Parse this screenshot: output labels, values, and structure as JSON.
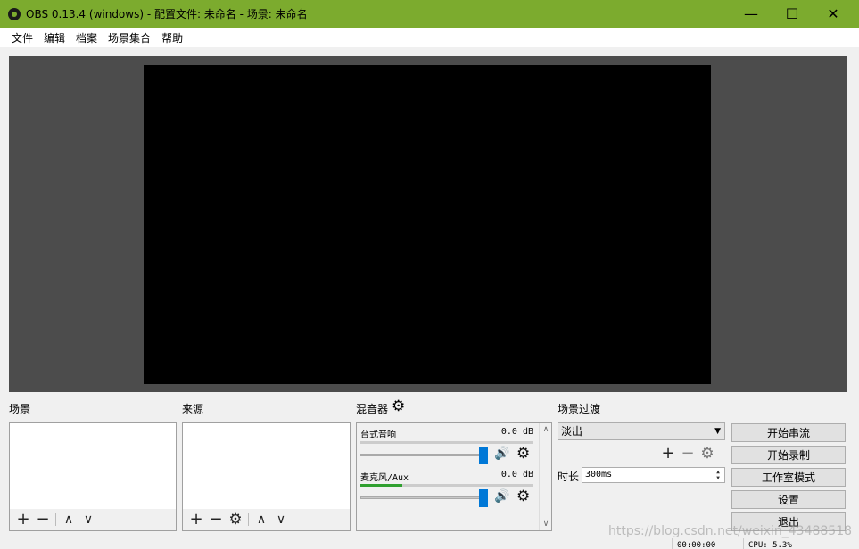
{
  "window": {
    "title": "OBS 0.13.4 (windows) - 配置文件: 未命名 - 场景: 未命名",
    "controls": {
      "minimize": "—",
      "maximize": "☐",
      "close": "✕"
    }
  },
  "menu": [
    "文件",
    "编辑",
    "档案",
    "场景集合",
    "帮助"
  ],
  "docks": {
    "scenes": {
      "title": "场景"
    },
    "sources": {
      "title": "来源"
    },
    "mixer": {
      "title": "混音器"
    },
    "transitions": {
      "title": "场景过渡"
    }
  },
  "toolbar_glyphs": {
    "add": "+",
    "remove": "−",
    "up": "∧",
    "down": "∨",
    "gear": "⚙"
  },
  "mixer": {
    "tracks": [
      {
        "name": "台式音响",
        "db": "0.0 dB",
        "level": 0.0
      },
      {
        "name": "麦克风/Aux",
        "db": "0.0 dB",
        "level": 0.24
      }
    ],
    "volume_icon": "🔊"
  },
  "transitions": {
    "selected": "淡出",
    "duration_label": "时长",
    "duration_value": "300ms"
  },
  "controls": {
    "start_streaming": "开始串流",
    "start_recording": "开始录制",
    "studio_mode": "工作室模式",
    "settings": "设置",
    "exit": "退出"
  },
  "status": {
    "time": "00:00:00",
    "cpu": "CPU: 5.3%"
  },
  "watermark": "https://blog.csdn.net/weixin_43488518",
  "colors": {
    "titlebar": "#7cab2e",
    "preview_bg": "#4c4c4c",
    "canvas": "#000000",
    "slider_handle": "#0078d7",
    "meter_fill": "#30a030"
  }
}
